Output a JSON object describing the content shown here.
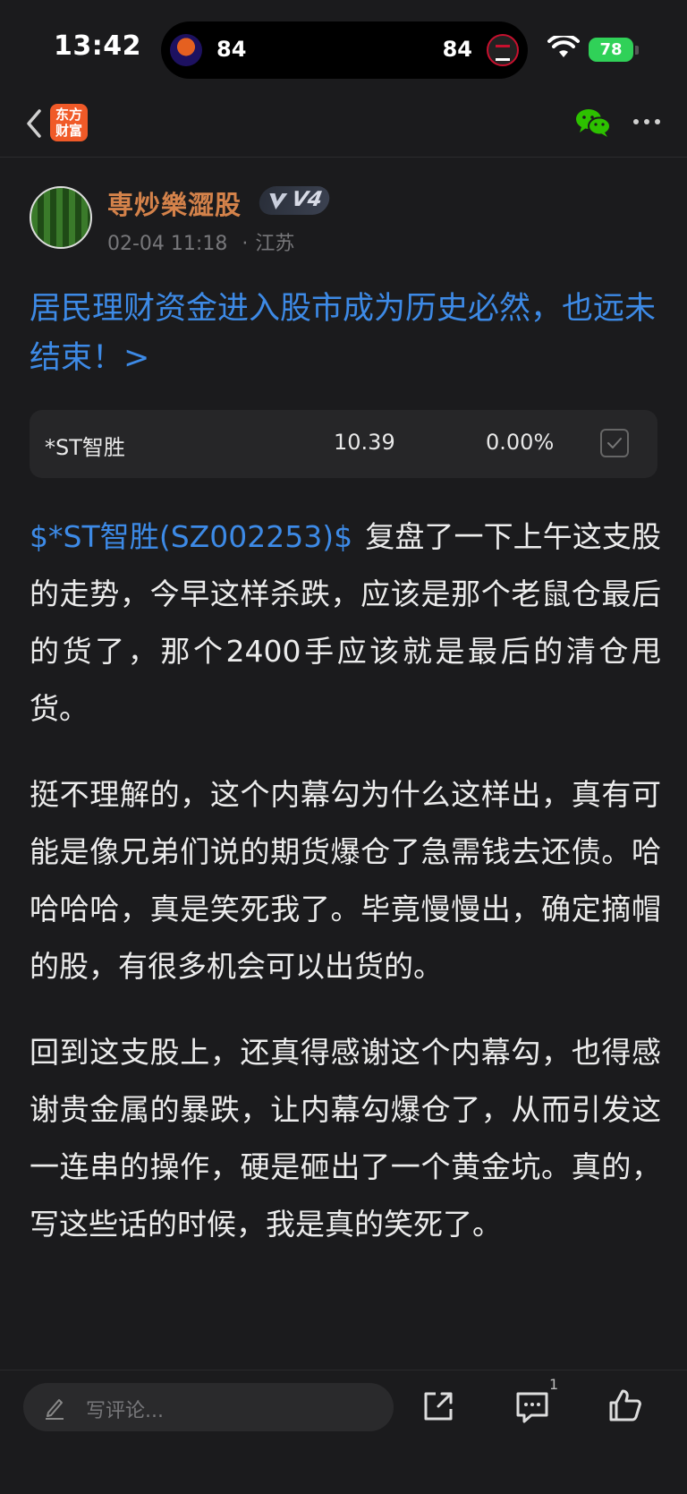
{
  "status_bar": {
    "time": "13:42",
    "left_score": "84",
    "right_score": "84",
    "battery": "78"
  },
  "nav": {
    "app_logo_line1": "东方",
    "app_logo_line2": "财富"
  },
  "author": {
    "name": "専炒樂澀股",
    "level": "V4",
    "date": "02-04 11:18",
    "separator": "·",
    "location": "江苏"
  },
  "post": {
    "title": "居民理财资金进入股市成为历史必然，也远未结束！>",
    "stock_card": {
      "name": "*ST智胜",
      "price": "10.39",
      "change": "0.00%"
    },
    "stock_link": "$*ST智胜(SZ002253)$",
    "paragraph1": "复盘了一下上午这支股的走势，今早这样杀跌，应该是那个老鼠仓最后的货了，那个2400手应该就是最后的清仓甩货。",
    "paragraph2": "挺不理解的，这个内幕勾为什么这样出，真有可能是像兄弟们说的期货爆仓了急需钱去还债。哈哈哈哈，真是笑死我了。毕竟慢慢出，确定摘帽的股，有很多机会可以出货的。",
    "paragraph3": "回到这支股上，还真得感谢这个内幕勾，也得感谢贵金属的暴跌，让内幕勾爆仓了，从而引发这一连串的操作，硬是砸出了一个黄金坑。真的，写这些话的时候，我是真的笑死了。"
  },
  "bottom_bar": {
    "comment_placeholder": "写评论...",
    "comment_count": "1"
  },
  "colors": {
    "background": "#1b1b1d",
    "link_blue": "#3d8ae6",
    "author_orange": "#d4824a",
    "wechat_green": "#2dc100",
    "battery_green": "#30d158",
    "logo_orange": "#f05a28"
  },
  "icons": [
    "back-icon",
    "wechat-icon",
    "more-icon",
    "pencil-icon",
    "share-icon",
    "comment-icon",
    "like-icon",
    "check-icon",
    "wifi-icon"
  ]
}
